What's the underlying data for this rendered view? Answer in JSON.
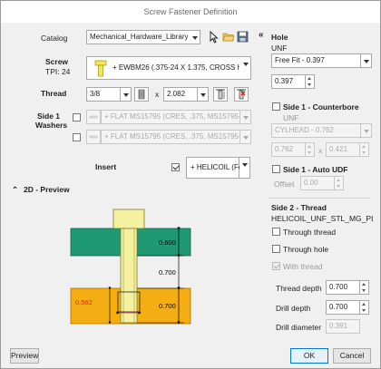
{
  "window": {
    "title": "Screw Fastener Definition"
  },
  "left": {
    "catalog_label": "Catalog",
    "catalog_value": "Mechanical_Hardware_Library",
    "screw_label": "Screw",
    "tpi_label": "TPI: 24",
    "screw_value": "+ EWBM26  (.375-24 X 1.375, CROSS HOL",
    "thread_label": "Thread",
    "thread_size": "3/8",
    "thread_x": "x",
    "thread_length": "2.082",
    "washers_label_1": "Side 1",
    "washers_label_2": "Washers",
    "washer1_value": "+ FLAT MS15795 (CRES, .375, MS15795-4",
    "washer2_value": "+ FLAT MS15795 (CRES, .375, MS15795-4",
    "insert_label": "Insert",
    "insert_value": "+ HELICOIL (Fo",
    "preview_section": "2D - Preview",
    "preview_button": "Preview"
  },
  "preview": {
    "dim_top": "0.600",
    "dim_mid": "0.700",
    "dim_bot": "0.700",
    "dim_insert": "0.562"
  },
  "right": {
    "collapse": "«",
    "hole_title": "Hole",
    "hole_std": "UNF",
    "fit_value": "Free Fit - 0.397",
    "diameter_value": "0.397",
    "cb_title": "Side 1 - Counterbore",
    "cb_std": "UNF",
    "cb_head": "CYLHEAD - 0.762",
    "cb_dia": "0.762",
    "cb_x": "x",
    "cb_depth": "0.421",
    "udf_title": "Side 1 - Auto UDF",
    "offset_label": "Offset",
    "offset_value": "0.00",
    "side2_title": "Side 2 - Thread",
    "side2_name": "HELICOIL_UNF_STL_MG_PLS...",
    "through_thread": "Through thread",
    "through_hole": "Through hole",
    "with_thread": "With thread",
    "thread_depth_label": "Thread depth",
    "thread_depth_value": "0.700",
    "drill_depth_label": "Drill depth",
    "drill_depth_value": "0.700",
    "drill_dia_label": "Drill diameter",
    "drill_dia_value": "0.391"
  },
  "footer": {
    "ok": "OK",
    "cancel": "Cancel"
  },
  "colors": {
    "plate": "#1e9973",
    "insert": "#f5ad14",
    "screw": "#f4f2a0",
    "accent": "#0078d7"
  }
}
